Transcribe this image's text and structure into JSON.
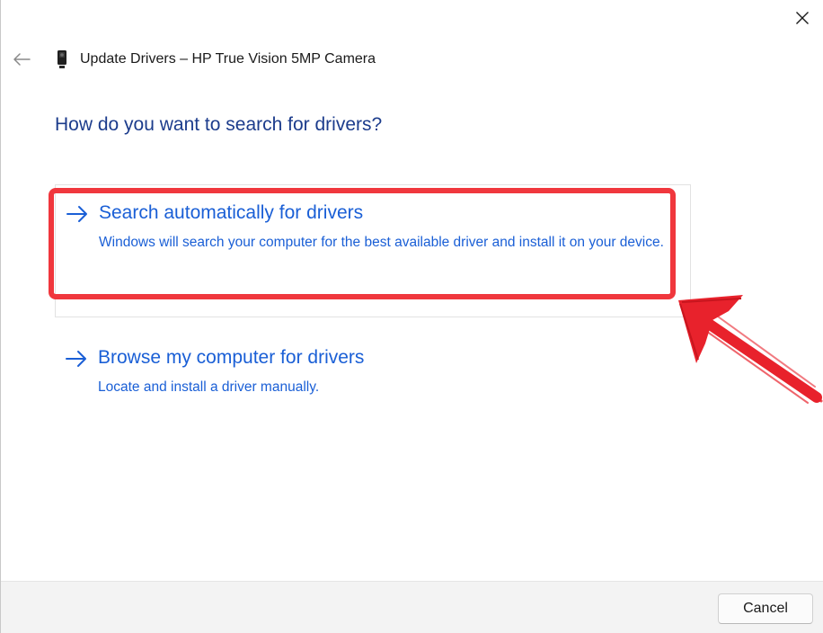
{
  "window": {
    "title": "Update Drivers – HP True Vision 5MP Camera",
    "close_icon": "close-icon",
    "back_icon": "back-arrow-icon",
    "device_icon": "camera-device-icon"
  },
  "main": {
    "heading": "How do you want to search for drivers?",
    "options": [
      {
        "icon": "arrow-right-icon",
        "title": "Search automatically for drivers",
        "description": "Windows will search your computer for the best available driver and install it on your device."
      },
      {
        "icon": "arrow-right-icon",
        "title": "Browse my computer for drivers",
        "description": "Locate and install a driver manually."
      }
    ]
  },
  "footer": {
    "cancel_label": "Cancel"
  },
  "annotation": {
    "highlight_color": "#f0373d",
    "arrow_color": "#e8222c"
  },
  "colors": {
    "link": "#1a5fd6",
    "heading": "#1c3c8c"
  }
}
